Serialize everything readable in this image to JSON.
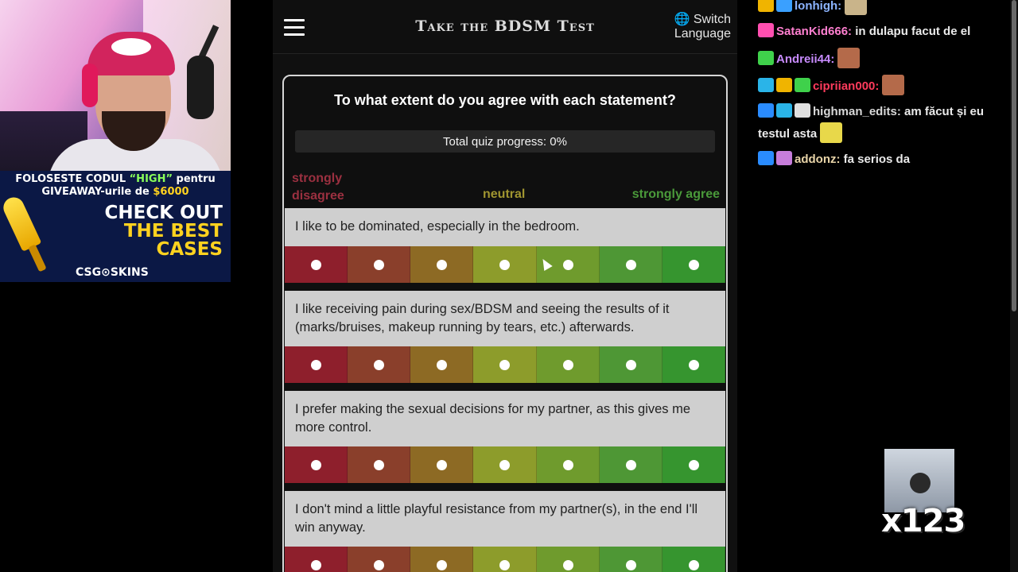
{
  "overlay": {
    "promo_line1_prefix": "FOLOSESTE CODUL ",
    "promo_code": "“HIGH”",
    "promo_line1_suffix": " pentru",
    "promo_line2_prefix": "GIVEAWAY-urile de ",
    "promo_amount": "$6000",
    "cta_line1": "CHECK OUT",
    "cta_line2": "THE BEST",
    "cta_line3": "CASES",
    "brand": "CSG⊙SKINS"
  },
  "header": {
    "title": "Take the BDSM Test",
    "lang_icon": "globe-icon",
    "lang_line1": "Switch",
    "lang_line2": "Language"
  },
  "quiz": {
    "question": "To what extent do you agree with each statement?",
    "progress_label": "Total quiz progress: 0%",
    "progress_fraction": 0,
    "scale": {
      "left_line1": "strongly",
      "left_line2": "disagree",
      "middle": "neutral",
      "right": "strongly agree"
    },
    "option_colors": [
      "#8e1f2c",
      "#8a3f2b",
      "#8d6a24",
      "#8d9c2b",
      "#6f9b2d",
      "#4e9735",
      "#36952f"
    ],
    "statements": [
      {
        "text": "I like to be dominated, especially in the bedroom."
      },
      {
        "text": "I like receiving pain during sex/BDSM and seeing the results of it (marks/bruises, makeup running by tears, etc.) afterwards."
      },
      {
        "text": "I prefer making the sexual decisions for my partner, as this gives me more control."
      },
      {
        "text": "I don't mind a little playful resistance from my partner(s), in the end I'll win anyway."
      }
    ]
  },
  "chat": {
    "messages": [
      {
        "user": "lonhigh:",
        "color": "#8cb4ff",
        "text": "",
        "badges": [
          "#f0b400",
          "#3aa0ff"
        ],
        "emote": "#c9b48a"
      },
      {
        "user": "SatanKid666:",
        "color": "#ff7fd0",
        "text": "in dulapu facut de el",
        "badges": [
          "#ff4fb0"
        ],
        "emote": ""
      },
      {
        "user": "Andreii44:",
        "color": "#c88bff",
        "text": "",
        "badges": [
          "#3fd14b"
        ],
        "emote": "#b46a4a"
      },
      {
        "user": "cipriian000:",
        "color": "#ff3b5c",
        "text": "",
        "badges": [
          "#2ab4e8",
          "#f0b400",
          "#3fd14b"
        ],
        "emote": "#b46a4a"
      },
      {
        "user": "highman_edits:",
        "color": "#d8d8d8",
        "text": "am făcut și eu testul asta",
        "badges": [
          "#2a8cff",
          "#2ab4e8",
          "#e0e0e0"
        ],
        "emote": "#e8d84a"
      },
      {
        "user": "addonz:",
        "color": "#e8d4a8",
        "text": "fa serios da",
        "badges": [
          "#2a8cff",
          "#c77ddb"
        ],
        "emote": ""
      }
    ],
    "combo_count": "x123"
  }
}
